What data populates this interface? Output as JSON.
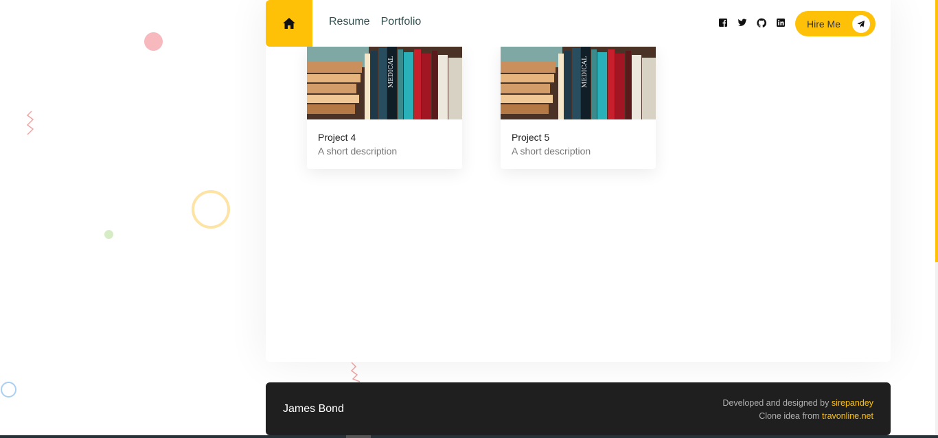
{
  "nav": {
    "home_icon": "home-icon",
    "links": [
      {
        "label": "Resume"
      },
      {
        "label": "Portfolio"
      }
    ]
  },
  "socials": [
    "facebook-icon",
    "twitter-icon",
    "github-icon",
    "linkedin-icon"
  ],
  "hire": {
    "label": "Hire Me",
    "icon": "telegram-send-icon"
  },
  "projects": [
    {
      "title": "Project 4",
      "description": "A short description",
      "image": "bookshelf-image"
    },
    {
      "title": "Project 5",
      "description": "A short description",
      "image": "bookshelf-image"
    }
  ],
  "footer": {
    "name": "James Bond",
    "credit_prefix": "Developed and designed by",
    "credit_author": "sirepandey",
    "clone_prefix": "Clone idea from",
    "clone_source": "travonline.net"
  },
  "colors": {
    "accent": "#ffc107",
    "footer_bg": "#1f1f1f",
    "text_dark": "#2f4f4f"
  }
}
